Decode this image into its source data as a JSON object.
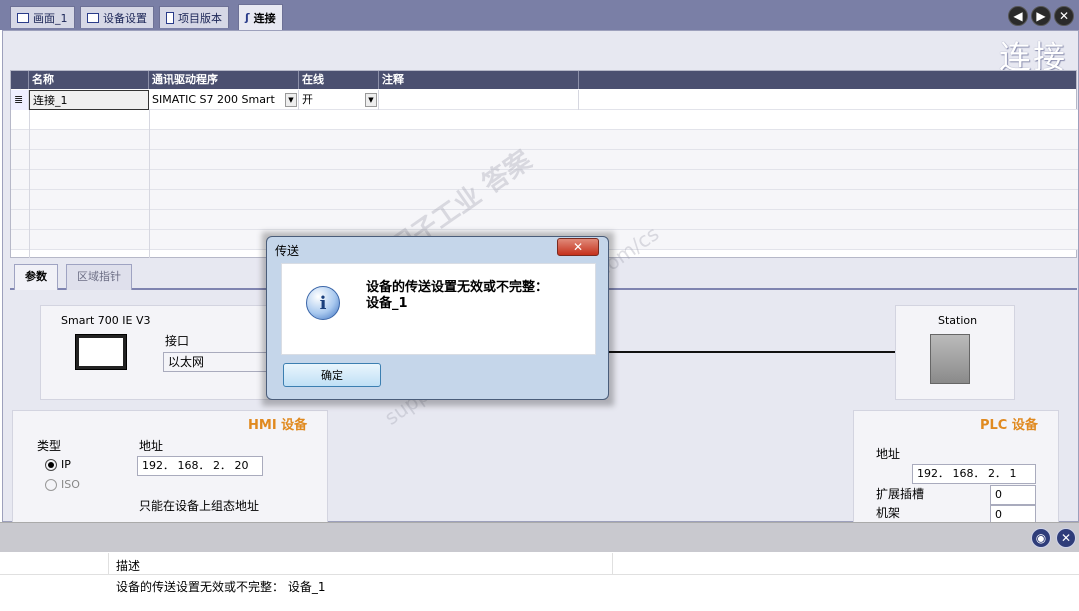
{
  "tabs": [
    {
      "label": "画面_1",
      "icon": "screen-icon"
    },
    {
      "label": "设备设置",
      "icon": "device-settings-icon"
    },
    {
      "label": "项目版本",
      "icon": "project-version-icon"
    },
    {
      "label": "连接",
      "icon": "connection-icon",
      "active": true
    }
  ],
  "editor_title": "连接",
  "table": {
    "headers": [
      "名称",
      "通讯驱动程序",
      "在线",
      "注释"
    ],
    "rows": [
      {
        "name": "连接_1",
        "driver": "SIMATIC S7 200 Smart",
        "online": "开",
        "comment": ""
      }
    ]
  },
  "lower_tabs": [
    "参数",
    "区域指针"
  ],
  "hmi": {
    "device_name": "Smart 700 IE V3",
    "interface_label": "接口",
    "interface_value": "以太网",
    "section_title": "HMI 设备",
    "type_label": "类型",
    "type_options": [
      "IP",
      "ISO"
    ],
    "type_selected": "IP",
    "address_label": "地址",
    "address_value": "192． 168．  2．  20",
    "note": "只能在设备上组态地址"
  },
  "plc": {
    "station_label": "Station",
    "section_title": "PLC 设备",
    "address_label": "地址",
    "address_value": "192． 168．  2．  1",
    "slot_label": "扩展插槽",
    "slot_value": "0",
    "rack_label": "机架",
    "rack_value": "0"
  },
  "dialog": {
    "title": "传送",
    "close_label": "✕",
    "message_line1": "设备的传送设置无效或不完整：",
    "message_line2": "设备_1",
    "ok_label": "确定"
  },
  "output": {
    "header": "描述",
    "message": "设备的传送设置无效或不完整： 设备_1"
  },
  "watermark": {
    "line1": "西门子工业   答案",
    "line2": "support.industry.siemens.com/cs"
  },
  "colors": {
    "topbar": "#7a7fa6",
    "header_bg": "#4b5070",
    "section_title": "#e08a20",
    "dialog_bg": "#c5d6ea"
  }
}
